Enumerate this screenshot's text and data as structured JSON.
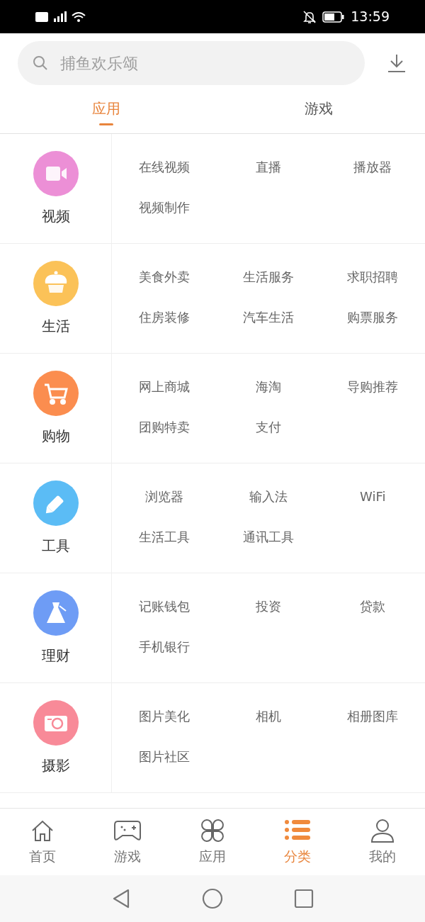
{
  "status_bar": {
    "time": "13:59"
  },
  "search": {
    "placeholder": "捕鱼欢乐颂"
  },
  "tabs": [
    {
      "label": "应用",
      "selected": true
    },
    {
      "label": "游戏",
      "selected": false
    }
  ],
  "categories": [
    {
      "name": "视频",
      "kind": "video",
      "color": "#ec8fd6",
      "items": [
        "在线视频",
        "直播",
        "播放器",
        "视频制作"
      ]
    },
    {
      "name": "生活",
      "kind": "food",
      "color": "#fbc258",
      "items": [
        "美食外卖",
        "生活服务",
        "求职招聘",
        "住房装修",
        "汽车生活",
        "购票服务"
      ]
    },
    {
      "name": "购物",
      "kind": "cart",
      "color": "#fb8d4f",
      "items": [
        "网上商城",
        "海淘",
        "导购推荐",
        "团购特卖",
        "支付"
      ]
    },
    {
      "name": "工具",
      "kind": "pencil",
      "color": "#5bbcf5",
      "items": [
        "浏览器",
        "输入法",
        "WiFi",
        "生活工具",
        "通讯工具"
      ]
    },
    {
      "name": "理财",
      "kind": "flask",
      "color": "#6e9cf5",
      "items": [
        "记账钱包",
        "投资",
        "贷款",
        "手机银行"
      ]
    },
    {
      "name": "摄影",
      "kind": "camera",
      "color": "#f88a98",
      "items": [
        "图片美化",
        "相机",
        "相册图库",
        "图片社区"
      ]
    }
  ],
  "bottom_nav": [
    {
      "label": "首页",
      "kind": "home",
      "selected": false
    },
    {
      "label": "游戏",
      "kind": "gamepad",
      "selected": false
    },
    {
      "label": "应用",
      "kind": "apps",
      "selected": false
    },
    {
      "label": "分类",
      "kind": "list",
      "selected": true
    },
    {
      "label": "我的",
      "kind": "person",
      "selected": false
    }
  ]
}
